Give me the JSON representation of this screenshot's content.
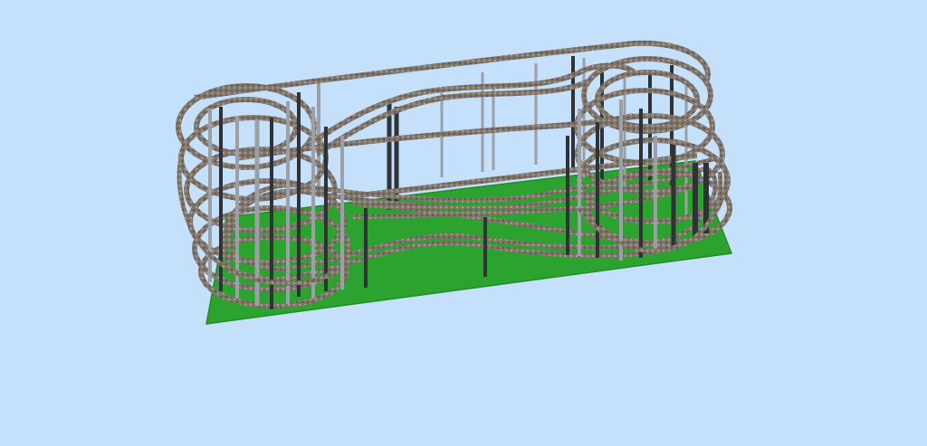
{
  "viewport": {
    "background_color": "#c4e0fb"
  },
  "scene": {
    "description_icon": "model-railway-3d-view",
    "baseboard_color": "#2da32f",
    "baseboard_edge_color": "#238c26",
    "track_color": "#8a7e73",
    "track_highlight_color": "#b3a79a",
    "pillar_light_color": "#9aa0a6",
    "pillar_dark_color": "#2f3236"
  }
}
